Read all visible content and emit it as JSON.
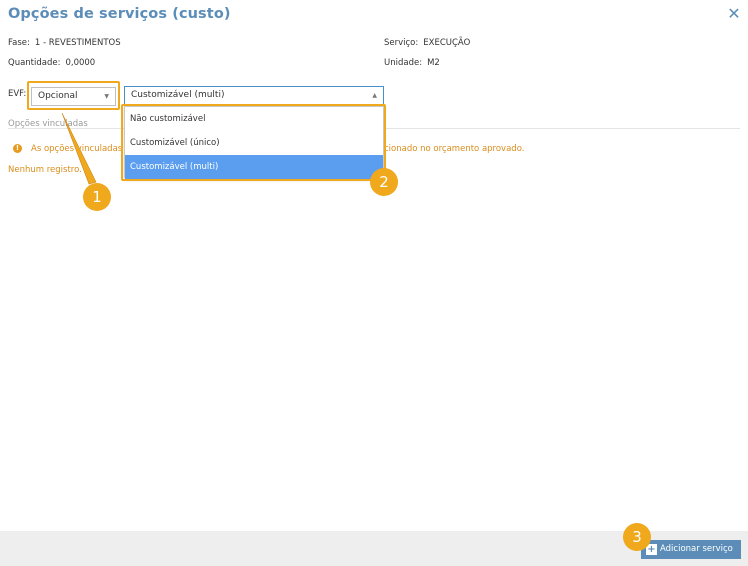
{
  "dialog": {
    "title": "Opções de serviços (custo)",
    "close_icon": "close-icon"
  },
  "info": {
    "fase_label": "Fase:",
    "fase_value": "1 - REVESTIMENTOS",
    "servico_label": "Serviço:",
    "servico_value": "EXECUÇÃO",
    "quantidade_label": "Quantidade:",
    "quantidade_value": "0,0000",
    "unidade_label": "Unidade:",
    "unidade_value": "M2"
  },
  "evf": {
    "label": "EVF:",
    "selected": "Opcional"
  },
  "customization": {
    "selected": "Customizável (multi)",
    "options": [
      "Não customizável",
      "Customizável (único)",
      "Customizável (multi)"
    ]
  },
  "section": {
    "title": "Opções vinculadas",
    "warning_start": "As opções vinculadas",
    "warning_end": "cionado no orçamento aprovado.",
    "empty": "Nenhum registro."
  },
  "callouts": [
    "1",
    "2",
    "3"
  ],
  "footer": {
    "add_button": "Adicionar serviço",
    "add_icon": "plus-icon"
  },
  "colors": {
    "accent": "#5b8db8",
    "highlight": "#f0a81c",
    "warning": "#d98d1a",
    "selected_option": "#5b9ef0"
  }
}
